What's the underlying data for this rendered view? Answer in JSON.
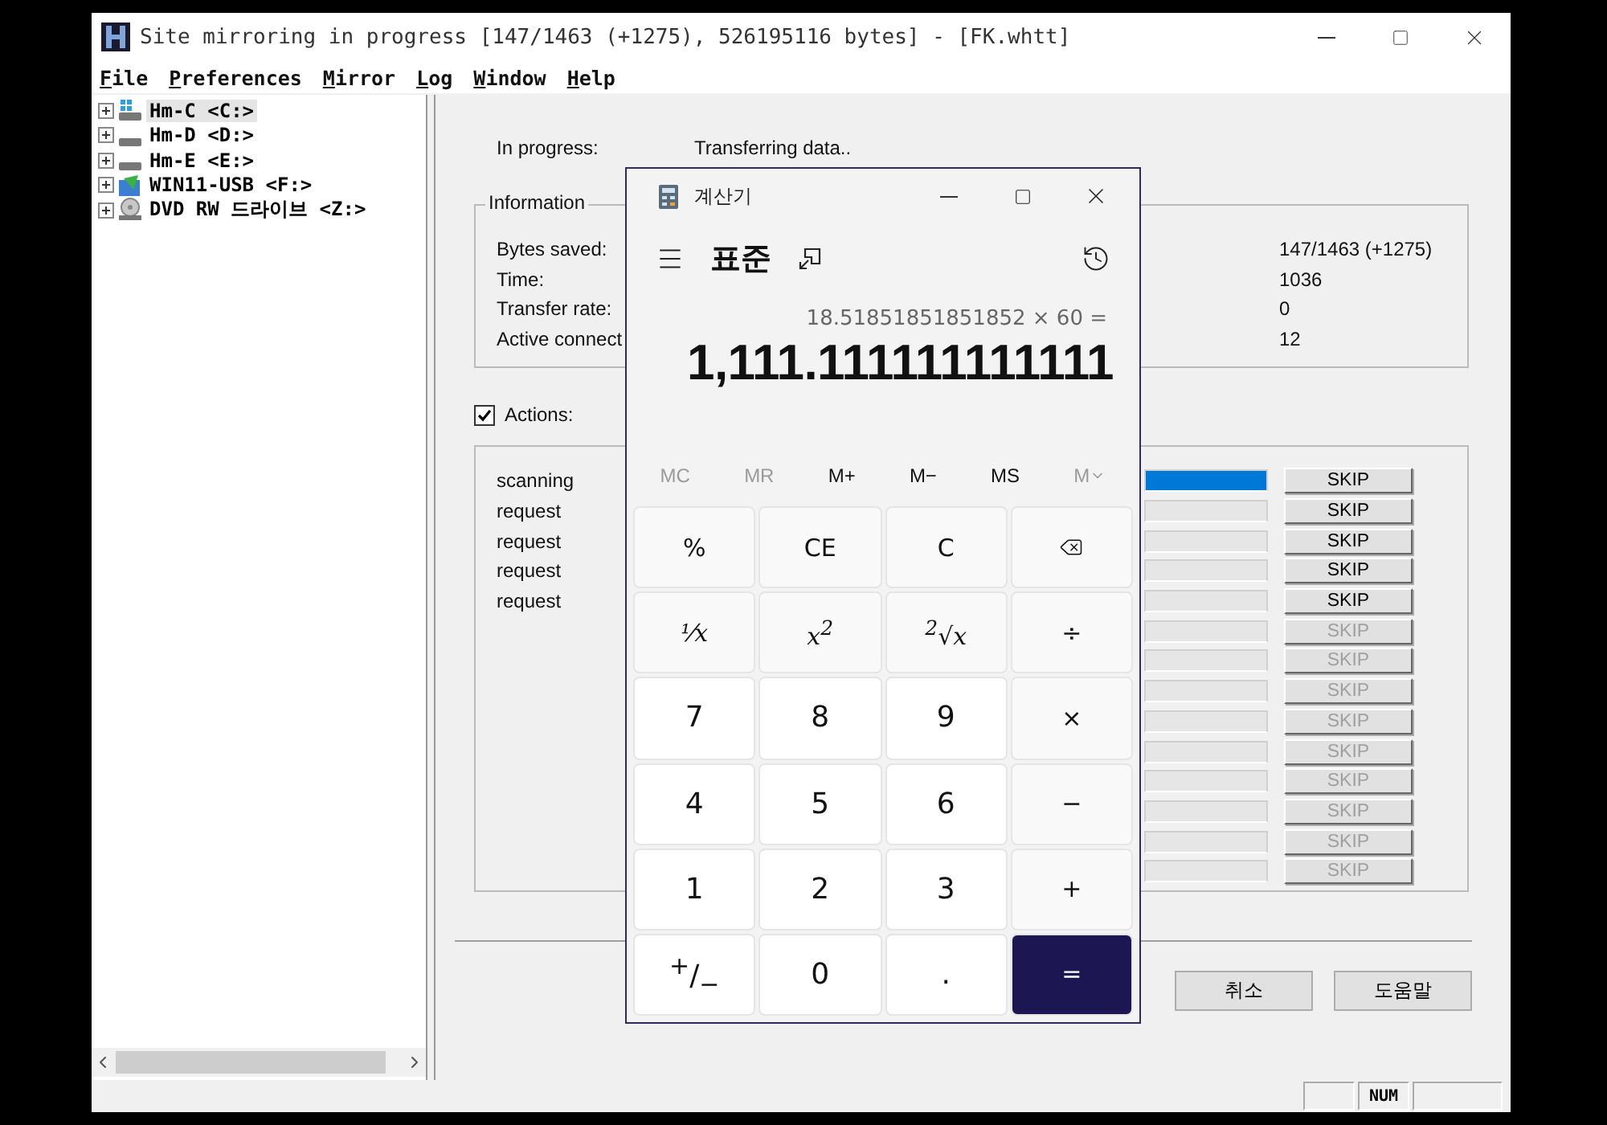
{
  "window": {
    "title": "Site mirroring in progress [147/1463 (+1275), 526195116 bytes] - [FK.whtt]"
  },
  "menu": [
    "File",
    "Preferences",
    "Mirror",
    "Log",
    "Window",
    "Help"
  ],
  "tree": [
    {
      "label": "Hm-C <C:>",
      "kind": "system",
      "selected": true
    },
    {
      "label": "Hm-D <D:>",
      "kind": "disk",
      "selected": false
    },
    {
      "label": "Hm-E <E:>",
      "kind": "disk",
      "selected": false
    },
    {
      "label": "WIN11-USB <F:>",
      "kind": "usb",
      "selected": false
    },
    {
      "label": "DVD RW 드라이브 <Z:>",
      "kind": "dvd",
      "selected": false
    }
  ],
  "progress": {
    "label": "In progress:",
    "value": "Transferring data.."
  },
  "information": {
    "title": "Information",
    "rows": [
      {
        "label": "Bytes saved:",
        "value": "147/1463 (+1275)"
      },
      {
        "label": "Time:",
        "value": "1036"
      },
      {
        "label": "Transfer rate:",
        "value": "0"
      },
      {
        "label": "Active connect",
        "value": "12"
      }
    ]
  },
  "actions": {
    "label": "Actions:",
    "checked": true,
    "rows": [
      {
        "label": "scanning",
        "level": 1,
        "skip": "SKIP",
        "disabled": false
      },
      {
        "label": "request",
        "skip": "SKIP",
        "disabled": false
      },
      {
        "label": "request",
        "skip": "SKIP",
        "disabled": false
      },
      {
        "label": "request",
        "skip": "SKIP",
        "disabled": false
      },
      {
        "label": "request",
        "skip": "SKIP",
        "disabled": false
      },
      {
        "skip": "SKIP",
        "disabled": true
      },
      {
        "skip": "SKIP",
        "disabled": true
      },
      {
        "skip": "SKIP",
        "disabled": true
      },
      {
        "skip": "SKIP",
        "disabled": true
      },
      {
        "skip": "SKIP",
        "disabled": true
      },
      {
        "skip": "SKIP",
        "disabled": true
      },
      {
        "skip": "SKIP",
        "disabled": true
      },
      {
        "skip": "SKIP",
        "disabled": true
      },
      {
        "skip": "SKIP",
        "disabled": true
      }
    ]
  },
  "dialog_buttons": [
    "취소",
    "도움말"
  ],
  "status_bar": {
    "num": "NUM"
  },
  "calculator": {
    "title": "계산기",
    "mode": "표준",
    "expression": "18.51851851851852 × 60 =",
    "result": "1,111.111111111111",
    "memory": [
      {
        "label": "MC",
        "disabled": true
      },
      {
        "label": "MR",
        "disabled": true
      },
      {
        "label": "M+",
        "disabled": false
      },
      {
        "label": "M−",
        "disabled": false
      },
      {
        "label": "MS",
        "disabled": false
      },
      {
        "label": "M",
        "disabled": true,
        "kind": "dropdown"
      }
    ],
    "keys": [
      {
        "label": "%",
        "kind": "function"
      },
      {
        "label": "CE",
        "kind": "function"
      },
      {
        "label": "C",
        "kind": "function"
      },
      {
        "kind": "backspace"
      },
      {
        "label": "⅟x",
        "kind": "math"
      },
      {
        "label": "x$^{2}$",
        "kind": "math"
      },
      {
        "label": "$^{2}$√x",
        "kind": "math"
      },
      {
        "label": "÷",
        "kind": "function"
      },
      {
        "label": "7",
        "kind": "digit"
      },
      {
        "label": "8",
        "kind": "digit"
      },
      {
        "label": "9",
        "kind": "digit"
      },
      {
        "label": "×",
        "kind": "function"
      },
      {
        "label": "4",
        "kind": "digit"
      },
      {
        "label": "5",
        "kind": "digit"
      },
      {
        "label": "6",
        "kind": "digit"
      },
      {
        "label": "−",
        "kind": "function"
      },
      {
        "label": "1",
        "kind": "digit"
      },
      {
        "label": "2",
        "kind": "digit"
      },
      {
        "label": "3",
        "kind": "digit"
      },
      {
        "label": "+",
        "kind": "function"
      },
      {
        "label": "$^{+}$/$_{−}$",
        "kind": "digit"
      },
      {
        "label": "0",
        "kind": "digit"
      },
      {
        "label": ".",
        "kind": "digit"
      },
      {
        "label": "=",
        "kind": "equals"
      }
    ]
  }
}
